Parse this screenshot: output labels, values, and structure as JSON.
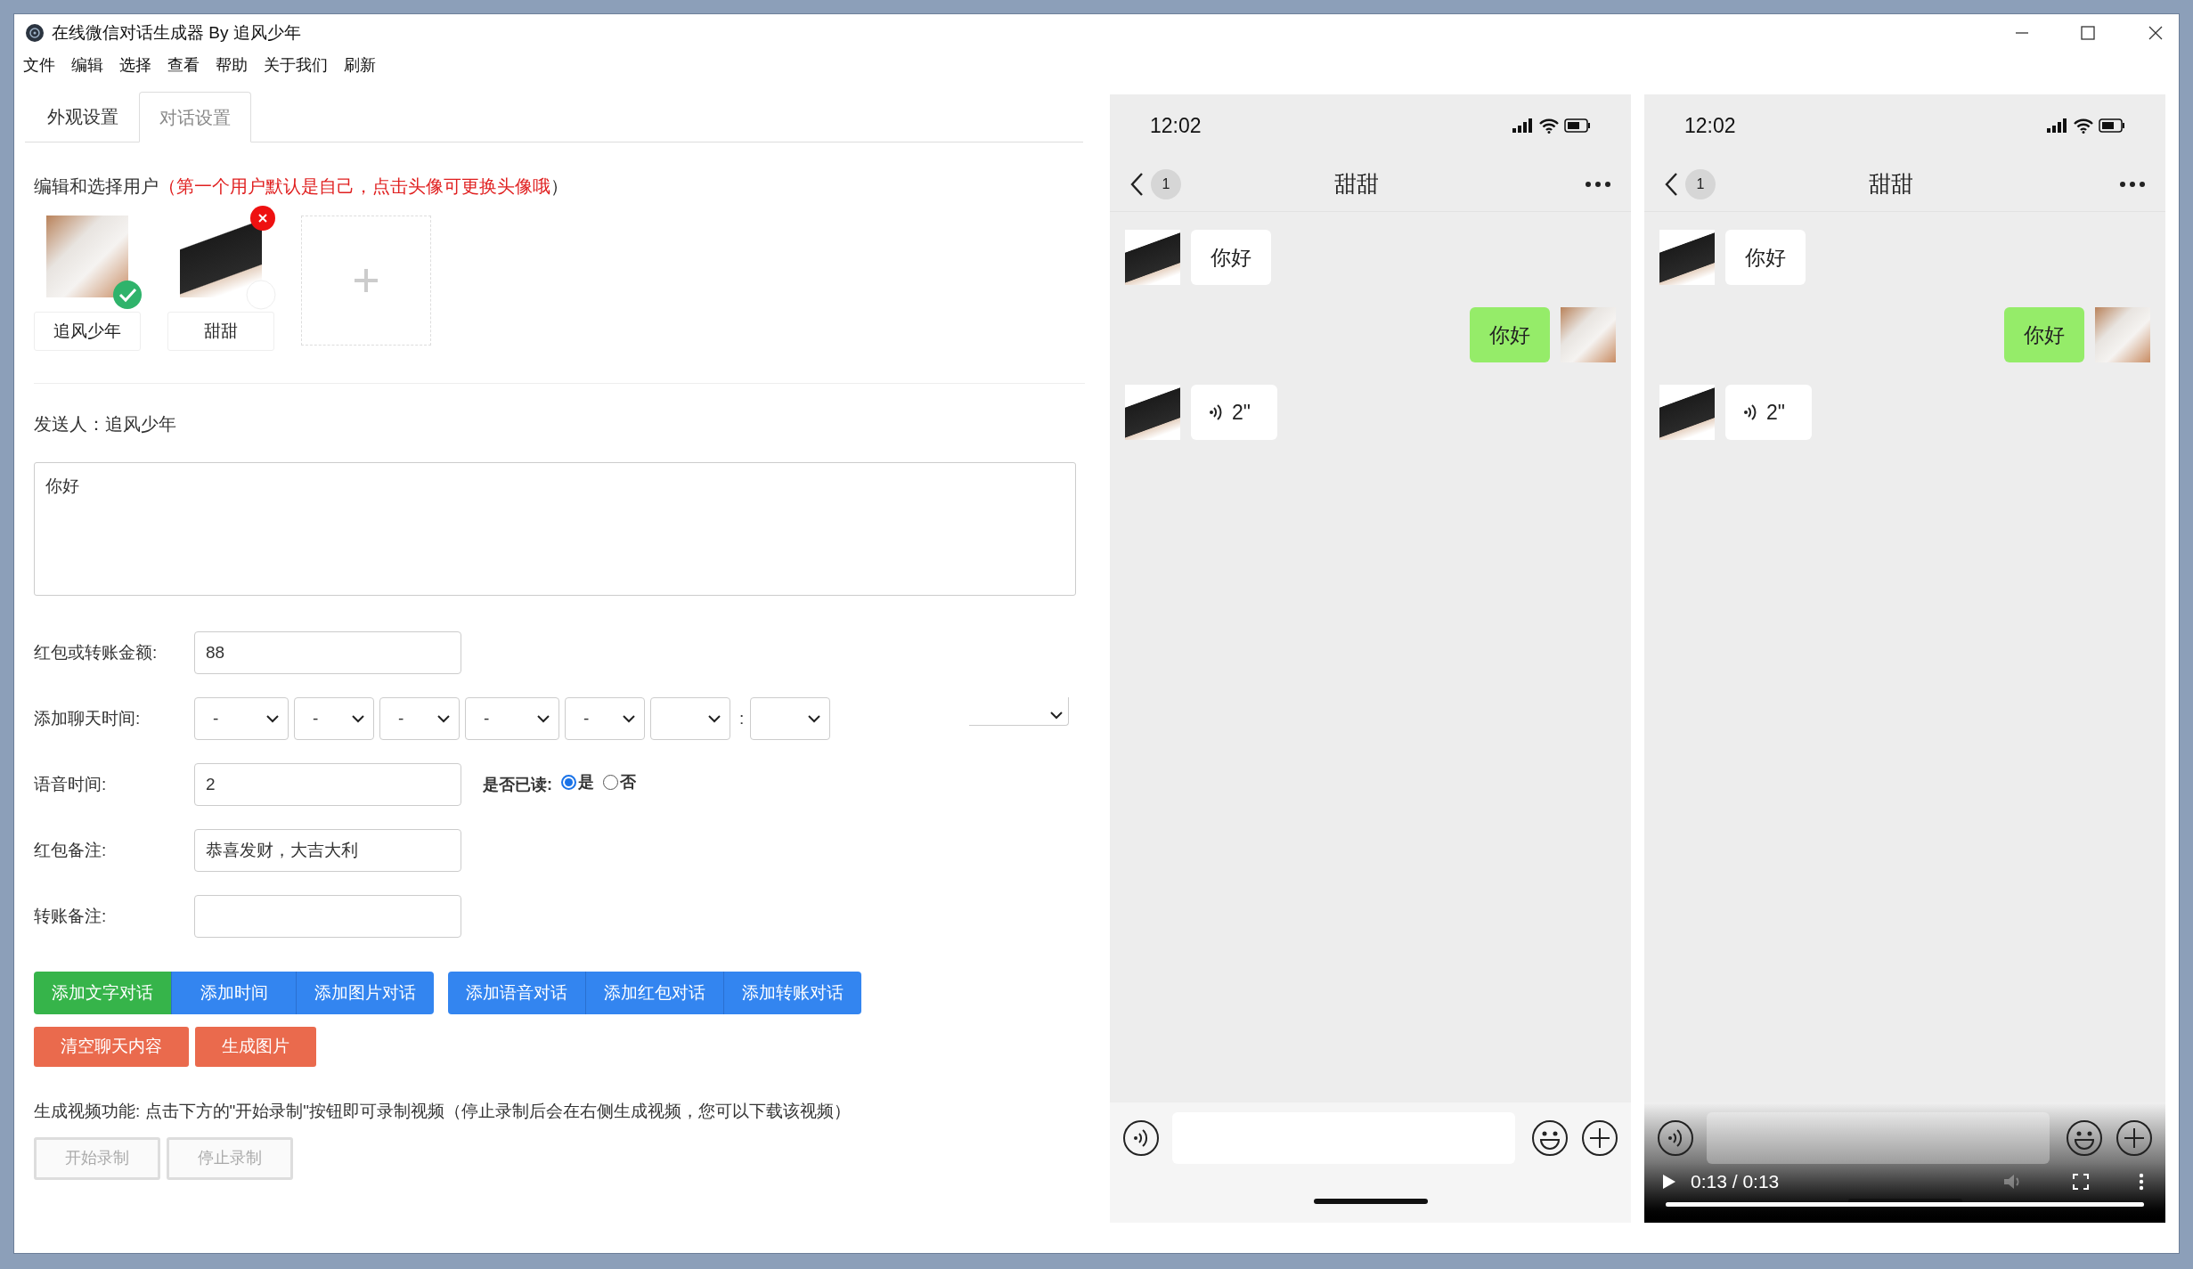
{
  "window": {
    "title": "在线微信对话生成器 By 追风少年"
  },
  "menu": [
    "文件",
    "编辑",
    "选择",
    "查看",
    "帮助",
    "关于我们",
    "刷新"
  ],
  "tabs": [
    {
      "label": "外观设置",
      "selected": false
    },
    {
      "label": "对话设置",
      "selected": true
    }
  ],
  "users_section": {
    "label": "编辑和选择用户",
    "note": "（第一个用户默认是自己，点击头像可更换头像哦",
    "note_end": "）"
  },
  "users": [
    {
      "name": "追风少年",
      "kind": "cat",
      "selected": true,
      "removable": false
    },
    {
      "name": "甜甜",
      "kind": "suit",
      "selected": false,
      "removable": true
    }
  ],
  "sender": "发送人：追风少年",
  "message": "你好",
  "amount": {
    "label": "红包或转账金额:",
    "value": "88"
  },
  "chat_time": {
    "label": "添加聊天时间:",
    "selects": [
      {
        "value": "-"
      },
      {
        "value": "-"
      },
      {
        "value": "-"
      },
      {
        "value": "-"
      },
      {
        "value": "-"
      },
      {
        "empty": true
      },
      {
        "empty": true
      }
    ],
    "separator": ":"
  },
  "voice": {
    "label": "语音时间:",
    "value": "2",
    "read_label": "是否已读:",
    "options": [
      {
        "label": "是",
        "selected": true
      },
      {
        "label": "否",
        "selected": false
      }
    ]
  },
  "red_packet_note": {
    "label": "红包备注:",
    "value": "恭喜发财，大吉大利"
  },
  "transfer_note": {
    "label": "转账备注:"
  },
  "button_groups": [
    [
      {
        "label": "添加文字对话",
        "kind": "success"
      },
      {
        "label": "添加时间",
        "kind": "primary"
      },
      {
        "label": "添加图片对话",
        "kind": "primary"
      }
    ],
    [
      {
        "label": "添加语音对话",
        "kind": "primary"
      },
      {
        "label": "添加红包对话",
        "kind": "primary"
      },
      {
        "label": "添加转账对话",
        "kind": "primary"
      }
    ],
    [
      {
        "label": "清空聊天内容",
        "kind": "danger"
      },
      {
        "label": "生成图片",
        "kind": "danger"
      }
    ]
  ],
  "video_note": "生成视频功能: 点击下方的\"开始录制\"按钮即可录制视频（停止录制后会在右侧生成视频，您可以下载该视频）",
  "record_buttons": [
    {
      "label": "开始录制",
      "disabled": true
    },
    {
      "label": "停止录制",
      "disabled": true
    }
  ],
  "phones": [
    {
      "time": "12:02",
      "back_count": "1",
      "title": "甜甜",
      "messages": [
        {
          "outgoing": false,
          "kind": "text",
          "text": "你好"
        },
        {
          "outgoing": true,
          "kind": "text",
          "text": "你好"
        },
        {
          "outgoing": false,
          "kind": "voice",
          "text": "2\""
        }
      ]
    },
    {
      "time": "12:02",
      "back_count": "1",
      "title": "甜甜",
      "messages": [
        {
          "outgoing": false,
          "kind": "text",
          "text": "你好"
        },
        {
          "outgoing": true,
          "kind": "text",
          "text": "你好"
        },
        {
          "outgoing": false,
          "kind": "voice",
          "text": "2\""
        }
      ],
      "video": {
        "time": "0:13 / 0:13",
        "level": 1
      }
    }
  ]
}
